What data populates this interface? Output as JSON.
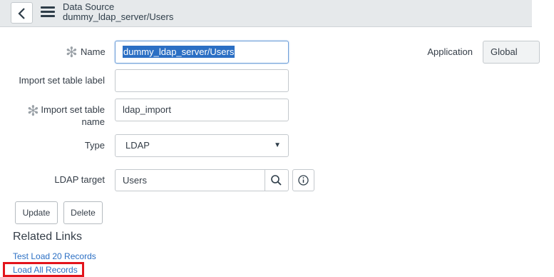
{
  "header": {
    "title": "Data Source",
    "subtitle": "dummy_ldap_server/Users"
  },
  "form": {
    "name_label": "Name",
    "name_value": "dummy_ldap_server/Users",
    "import_label_label": "Import set table label",
    "import_label_value": "",
    "import_name_label_line1": "Import set table",
    "import_name_label_line2": "name",
    "import_name_value": "ldap_import",
    "type_label": "Type",
    "type_value": "LDAP",
    "ldap_target_label": "LDAP target",
    "ldap_target_value": "Users",
    "application_label": "Application",
    "application_value": "Global",
    "required_mark": "✻"
  },
  "buttons": {
    "update": "Update",
    "delete": "Delete"
  },
  "related_links": {
    "heading": "Related Links",
    "items": [
      "Test Load 20 Records",
      "Load All Records"
    ]
  },
  "colors": {
    "link": "#2b6fc4",
    "highlight": "#e3141c"
  }
}
